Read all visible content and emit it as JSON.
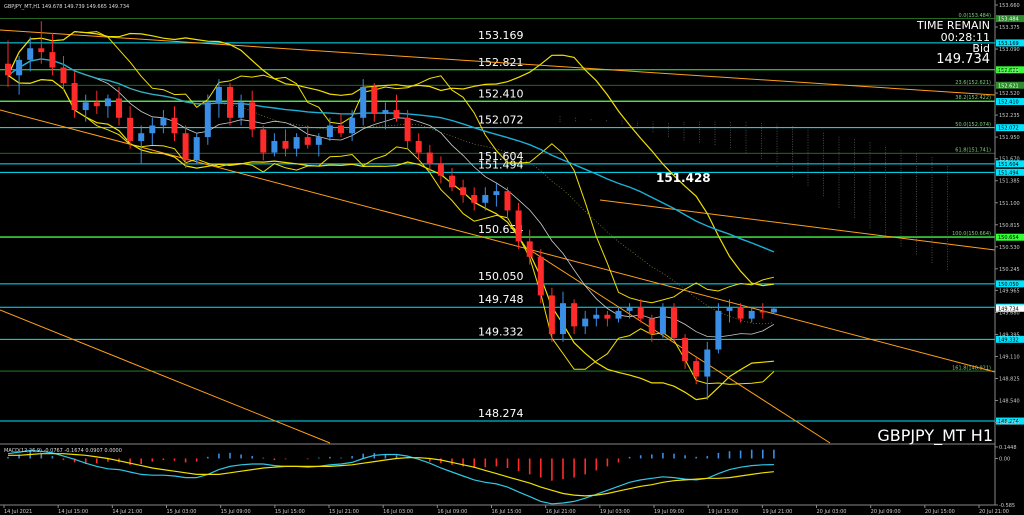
{
  "chart_data": {
    "type": "candlestick",
    "symbol_header": "GBPJPY_MT,H1  149.678 149.739 149.665 149.734",
    "watermark": "GBPJPY_MT H1",
    "time_remain": {
      "label": "TIME REMAIN",
      "value": "00:28:11"
    },
    "bid": {
      "label": "Bid",
      "value": "149.734"
    },
    "price_axis": {
      "ylim": [
        147.99,
        153.66
      ],
      "ticks": [
        153.66,
        153.375,
        153.09,
        152.805,
        152.52,
        152.235,
        151.95,
        151.67,
        151.385,
        151.1,
        150.815,
        150.53,
        150.245,
        149.965,
        149.68,
        149.395,
        149.11,
        148.825,
        148.54,
        148.255
      ]
    },
    "levels": [
      {
        "value": 153.169,
        "label": "153.169",
        "axis_label": "153.169",
        "color": "#00e5ff"
      },
      {
        "value": 152.821,
        "label": "152.821",
        "axis_label": "152.821",
        "color": "#33ff33"
      },
      {
        "value": 152.41,
        "label": "152.410",
        "axis_label": "152.410",
        "color": "#00e5ff"
      },
      {
        "value": 152.072,
        "label": "152.072",
        "axis_label": "152.072",
        "color": "#00e5ff"
      },
      {
        "value": 151.604,
        "label": "151.604",
        "axis_label": "151.604",
        "color": "#00e5ff"
      },
      {
        "value": 151.494,
        "label": "151.494",
        "axis_label": "151.494",
        "color": "#00e5ff"
      },
      {
        "value": 150.654,
        "label": "150.654",
        "axis_label": "150.654",
        "color": "#33ff33"
      },
      {
        "value": 150.05,
        "label": "150.050",
        "axis_label": "150.050",
        "color": "#00e5ff"
      },
      {
        "value": 149.748,
        "label": "149.748",
        "axis_label": "149.748",
        "color": "#00e5ff"
      },
      {
        "value": 149.332,
        "label": "149.332",
        "axis_label": "149.332",
        "color": "#00e5ff"
      },
      {
        "value": 148.274,
        "label": "148.274",
        "axis_label": "148.274",
        "color": "#00e5ff"
      }
    ],
    "fib_levels": [
      {
        "value": 153.484,
        "label": "0.0(153.484)"
      },
      {
        "value": 152.621,
        "label": "23.6(152.621)"
      },
      {
        "value": 152.422,
        "label": "38.2(152.422)"
      },
      {
        "value": 152.074,
        "label": "50.0(152.074)"
      },
      {
        "value": 151.741,
        "label": "61.8(151.741)"
      },
      {
        "value": 150.664,
        "label": "100.0(150.664)"
      },
      {
        "value": 148.921,
        "label": "161.8(148.921)"
      }
    ],
    "fib_axis_labels": [
      "153.484",
      "152.621"
    ],
    "annotation": {
      "value": 151.428,
      "text": "151.428"
    },
    "bid_axis_label": "149.734",
    "x_labels": [
      "14 Jul 2021",
      "14 Jul 15:00",
      "14 Jul 21:00",
      "15 Jul 03:00",
      "15 Jul 09:00",
      "15 Jul 15:00",
      "15 Jul 21:00",
      "16 Jul 03:00",
      "16 Jul 09:00",
      "16 Jul 15:00",
      "16 Jul 21:00",
      "19 Jul 03:00",
      "19 Jul 09:00",
      "19 Jul 15:00",
      "19 Jul 21:00",
      "20 Jul 03:00",
      "20 Jul 09:00",
      "20 Jul 15:00",
      "20 Jul 21:00"
    ],
    "candles": [
      {
        "o": 152.9,
        "h": 153.2,
        "l": 152.6,
        "c": 152.75
      },
      {
        "o": 152.75,
        "h": 153.0,
        "l": 152.5,
        "c": 152.95
      },
      {
        "o": 152.95,
        "h": 153.25,
        "l": 152.8,
        "c": 153.1
      },
      {
        "o": 153.1,
        "h": 153.45,
        "l": 152.9,
        "c": 153.05
      },
      {
        "o": 153.05,
        "h": 153.3,
        "l": 152.75,
        "c": 152.85
      },
      {
        "o": 152.85,
        "h": 153.0,
        "l": 152.55,
        "c": 152.65
      },
      {
        "o": 152.65,
        "h": 152.8,
        "l": 152.2,
        "c": 152.3
      },
      {
        "o": 152.3,
        "h": 152.5,
        "l": 152.15,
        "c": 152.4
      },
      {
        "o": 152.4,
        "h": 152.55,
        "l": 152.25,
        "c": 152.35
      },
      {
        "o": 152.35,
        "h": 152.5,
        "l": 152.2,
        "c": 152.45
      },
      {
        "o": 152.45,
        "h": 152.6,
        "l": 152.1,
        "c": 152.2
      },
      {
        "o": 152.2,
        "h": 152.35,
        "l": 151.8,
        "c": 151.9
      },
      {
        "o": 151.9,
        "h": 152.1,
        "l": 151.6,
        "c": 152.0
      },
      {
        "o": 152.0,
        "h": 152.2,
        "l": 151.85,
        "c": 152.1
      },
      {
        "o": 152.1,
        "h": 152.3,
        "l": 152.0,
        "c": 152.2
      },
      {
        "o": 152.2,
        "h": 152.35,
        "l": 151.9,
        "c": 152.0
      },
      {
        "o": 152.0,
        "h": 152.1,
        "l": 151.55,
        "c": 151.65
      },
      {
        "o": 151.65,
        "h": 152.0,
        "l": 151.6,
        "c": 151.95
      },
      {
        "o": 151.95,
        "h": 152.5,
        "l": 151.85,
        "c": 152.4
      },
      {
        "o": 152.4,
        "h": 152.7,
        "l": 152.2,
        "c": 152.6
      },
      {
        "o": 152.6,
        "h": 152.65,
        "l": 152.1,
        "c": 152.2
      },
      {
        "o": 152.2,
        "h": 152.5,
        "l": 152.1,
        "c": 152.4
      },
      {
        "o": 152.4,
        "h": 152.55,
        "l": 151.95,
        "c": 152.05
      },
      {
        "o": 152.05,
        "h": 152.1,
        "l": 151.65,
        "c": 151.75
      },
      {
        "o": 151.75,
        "h": 152.0,
        "l": 151.7,
        "c": 151.9
      },
      {
        "o": 151.9,
        "h": 152.05,
        "l": 151.7,
        "c": 151.8
      },
      {
        "o": 151.8,
        "h": 152.0,
        "l": 151.7,
        "c": 151.95
      },
      {
        "o": 151.95,
        "h": 152.1,
        "l": 151.8,
        "c": 151.85
      },
      {
        "o": 151.85,
        "h": 152.0,
        "l": 151.7,
        "c": 151.95
      },
      {
        "o": 151.95,
        "h": 152.2,
        "l": 151.9,
        "c": 152.1
      },
      {
        "o": 152.1,
        "h": 152.25,
        "l": 151.95,
        "c": 152.0
      },
      {
        "o": 152.0,
        "h": 152.3,
        "l": 151.9,
        "c": 152.2
      },
      {
        "o": 152.2,
        "h": 152.7,
        "l": 152.1,
        "c": 152.6
      },
      {
        "o": 152.6,
        "h": 152.65,
        "l": 152.15,
        "c": 152.25
      },
      {
        "o": 152.25,
        "h": 152.4,
        "l": 152.05,
        "c": 152.3
      },
      {
        "o": 152.3,
        "h": 152.5,
        "l": 152.15,
        "c": 152.2
      },
      {
        "o": 152.2,
        "h": 152.3,
        "l": 151.8,
        "c": 151.9
      },
      {
        "o": 151.9,
        "h": 152.0,
        "l": 151.65,
        "c": 151.75
      },
      {
        "o": 151.75,
        "h": 151.85,
        "l": 151.5,
        "c": 151.6
      },
      {
        "o": 151.6,
        "h": 151.7,
        "l": 151.35,
        "c": 151.45
      },
      {
        "o": 151.45,
        "h": 151.55,
        "l": 151.25,
        "c": 151.3
      },
      {
        "o": 151.3,
        "h": 151.4,
        "l": 151.1,
        "c": 151.2
      },
      {
        "o": 151.2,
        "h": 151.3,
        "l": 151.0,
        "c": 151.1
      },
      {
        "o": 151.1,
        "h": 151.3,
        "l": 151.0,
        "c": 151.2
      },
      {
        "o": 151.2,
        "h": 151.35,
        "l": 151.05,
        "c": 151.25
      },
      {
        "o": 151.25,
        "h": 151.3,
        "l": 150.9,
        "c": 151.0
      },
      {
        "o": 151.0,
        "h": 151.1,
        "l": 150.5,
        "c": 150.6
      },
      {
        "o": 150.6,
        "h": 150.75,
        "l": 150.3,
        "c": 150.4
      },
      {
        "o": 150.4,
        "h": 150.5,
        "l": 149.8,
        "c": 149.9
      },
      {
        "o": 149.9,
        "h": 150.0,
        "l": 149.3,
        "c": 149.4
      },
      {
        "o": 149.4,
        "h": 149.95,
        "l": 149.3,
        "c": 149.8
      },
      {
        "o": 149.8,
        "h": 149.85,
        "l": 149.4,
        "c": 149.5
      },
      {
        "o": 149.5,
        "h": 149.7,
        "l": 149.4,
        "c": 149.6
      },
      {
        "o": 149.6,
        "h": 149.75,
        "l": 149.5,
        "c": 149.65
      },
      {
        "o": 149.65,
        "h": 149.7,
        "l": 149.5,
        "c": 149.6
      },
      {
        "o": 149.6,
        "h": 149.75,
        "l": 149.55,
        "c": 149.7
      },
      {
        "o": 149.7,
        "h": 149.8,
        "l": 149.6,
        "c": 149.75
      },
      {
        "o": 149.75,
        "h": 149.85,
        "l": 149.55,
        "c": 149.6
      },
      {
        "o": 149.6,
        "h": 149.65,
        "l": 149.3,
        "c": 149.4
      },
      {
        "o": 149.4,
        "h": 149.8,
        "l": 149.35,
        "c": 149.75
      },
      {
        "o": 149.75,
        "h": 149.8,
        "l": 149.3,
        "c": 149.35
      },
      {
        "o": 149.35,
        "h": 149.4,
        "l": 148.95,
        "c": 149.05
      },
      {
        "o": 149.05,
        "h": 149.1,
        "l": 148.75,
        "c": 148.85
      },
      {
        "o": 148.85,
        "h": 149.3,
        "l": 148.55,
        "c": 149.2
      },
      {
        "o": 149.2,
        "h": 149.8,
        "l": 149.15,
        "c": 149.7
      },
      {
        "o": 149.7,
        "h": 149.85,
        "l": 149.55,
        "c": 149.75
      },
      {
        "o": 149.75,
        "h": 149.8,
        "l": 149.55,
        "c": 149.6
      },
      {
        "o": 149.6,
        "h": 149.75,
        "l": 149.55,
        "c": 149.7
      },
      {
        "o": 149.7,
        "h": 149.8,
        "l": 149.6,
        "c": 149.68
      },
      {
        "o": 149.68,
        "h": 149.74,
        "l": 149.66,
        "c": 149.73
      }
    ],
    "indicator": {
      "label": "MACD(12,26,9) -0.0767 -0.1674 0.0907 0.0000",
      "ylim": [
        -0.585,
        0.144
      ],
      "ticks": [
        0.1448,
        0,
        -0.585
      ],
      "tick_labels": [
        "0.1448",
        "0.00",
        "-0.585"
      ],
      "histogram": [
        0.02,
        0.05,
        0.08,
        0.06,
        0.03,
        -0.02,
        -0.05,
        -0.07,
        -0.06,
        -0.04,
        -0.05,
        -0.08,
        -0.07,
        -0.04,
        -0.02,
        -0.03,
        -0.05,
        -0.04,
        0.02,
        0.06,
        0.07,
        0.05,
        0.03,
        0.01,
        -0.02,
        -0.01,
        0.0,
        -0.01,
        0.01,
        0.02,
        0.01,
        0.03,
        0.06,
        0.07,
        0.05,
        0.04,
        0.02,
        -0.01,
        -0.04,
        -0.06,
        -0.08,
        -0.1,
        -0.12,
        -0.11,
        -0.1,
        -0.12,
        -0.16,
        -0.2,
        -0.24,
        -0.28,
        -0.26,
        -0.24,
        -0.2,
        -0.15,
        -0.1,
        -0.05,
        0.02,
        0.04,
        0.05,
        0.07,
        0.06,
        0.04,
        0.02,
        0.03,
        0.07,
        0.09,
        0.1,
        0.11,
        0.11,
        0.11
      ],
      "macd": [
        0.06,
        0.08,
        0.1,
        0.09,
        0.07,
        0.03,
        -0.01,
        -0.06,
        -0.1,
        -0.13,
        -0.14,
        -0.17,
        -0.2,
        -0.21,
        -0.21,
        -0.22,
        -0.24,
        -0.24,
        -0.2,
        -0.14,
        -0.1,
        -0.08,
        -0.07,
        -0.07,
        -0.09,
        -0.1,
        -0.1,
        -0.11,
        -0.1,
        -0.08,
        -0.07,
        -0.05,
        0.0,
        0.04,
        0.05,
        0.05,
        0.03,
        -0.01,
        -0.06,
        -0.12,
        -0.17,
        -0.22,
        -0.27,
        -0.3,
        -0.32,
        -0.36,
        -0.42,
        -0.48,
        -0.54,
        -0.57,
        -0.56,
        -0.54,
        -0.5,
        -0.45,
        -0.4,
        -0.35,
        -0.3,
        -0.27,
        -0.25,
        -0.23,
        -0.24,
        -0.26,
        -0.27,
        -0.25,
        -0.19,
        -0.14,
        -0.11,
        -0.09,
        -0.08,
        -0.077
      ],
      "signal": [
        0.04,
        0.04,
        0.05,
        0.06,
        0.06,
        0.06,
        0.05,
        0.04,
        0.02,
        0.0,
        -0.03,
        -0.06,
        -0.09,
        -0.12,
        -0.14,
        -0.16,
        -0.18,
        -0.2,
        -0.2,
        -0.2,
        -0.18,
        -0.16,
        -0.14,
        -0.12,
        -0.11,
        -0.1,
        -0.1,
        -0.1,
        -0.1,
        -0.1,
        -0.09,
        -0.08,
        -0.06,
        -0.04,
        -0.02,
        0.0,
        0.01,
        0.01,
        0.0,
        -0.02,
        -0.05,
        -0.08,
        -0.11,
        -0.15,
        -0.19,
        -0.23,
        -0.27,
        -0.31,
        -0.36,
        -0.4,
        -0.44,
        -0.46,
        -0.47,
        -0.46,
        -0.44,
        -0.41,
        -0.38,
        -0.35,
        -0.33,
        -0.3,
        -0.28,
        -0.27,
        -0.26,
        -0.25,
        -0.25,
        -0.24,
        -0.22,
        -0.2,
        -0.18,
        -0.167
      ]
    },
    "colors": {
      "bull": "#3a8ee6",
      "bear": "#ff2a2a",
      "bands": "#f0e000",
      "level_cyan": "#00e5ff",
      "level_green": "#33ff33",
      "trend": "#ff9f1a",
      "ma": "#1ab0d8",
      "macd": "#2ec7e6",
      "signal": "#f0e000"
    }
  }
}
